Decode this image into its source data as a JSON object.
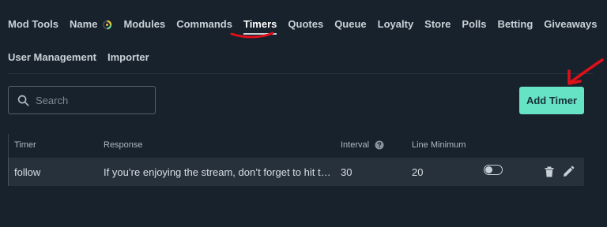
{
  "nav": {
    "row1": [
      {
        "label": "Mod Tools",
        "active": false
      },
      {
        "label": "Name",
        "active": false
      },
      {
        "label": "Modules",
        "active": false
      },
      {
        "label": "Commands",
        "active": false
      },
      {
        "label": "Timers",
        "active": true
      },
      {
        "label": "Quotes",
        "active": false
      },
      {
        "label": "Queue",
        "active": false
      },
      {
        "label": "Loyalty",
        "active": false
      },
      {
        "label": "Store",
        "active": false
      },
      {
        "label": "Polls",
        "active": false
      },
      {
        "label": "Betting",
        "active": false
      },
      {
        "label": "Giveaways",
        "active": false
      }
    ],
    "row2": [
      {
        "label": "User Management",
        "active": false
      },
      {
        "label": "Importer",
        "active": false
      }
    ]
  },
  "search": {
    "placeholder": "Search",
    "value": "",
    "icon": "search-icon"
  },
  "add_button": {
    "label": "Add Timer"
  },
  "table": {
    "headers": {
      "timer": "Timer",
      "response": "Response",
      "interval": "Interval",
      "line_minimum": "Line Minimum"
    },
    "rows": [
      {
        "timer": "follow",
        "response": "If you’re enjoying the stream, don’t forget to hit the follow button!",
        "interval": "30",
        "line_minimum": "20",
        "enabled": false
      }
    ]
  },
  "colors": {
    "background": "#18222c",
    "accent_button": "#66e3c4",
    "row_background": "#26313c",
    "annotation": "#e0101a"
  }
}
